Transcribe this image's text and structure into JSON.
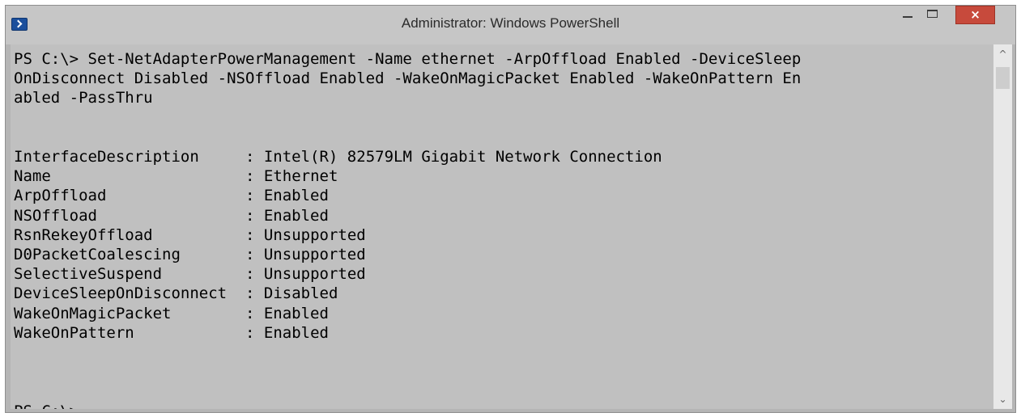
{
  "window": {
    "title": "Administrator: Windows PowerShell",
    "icon": "powershell-icon",
    "controls": {
      "close_glyph": "×"
    }
  },
  "console": {
    "command_lines": [
      "PS C:\\> Set-NetAdapterPowerManagement -Name ethernet -ArpOffload Enabled -DeviceSleep",
      "OnDisconnect Disabled -NSOffload Enabled -WakeOnMagicPacket Enabled -WakeOnPattern En",
      "abled -PassThru"
    ],
    "properties": [
      {
        "name": "InterfaceDescription",
        "value": "Intel(R) 82579LM Gigabit Network Connection"
      },
      {
        "name": "Name",
        "value": "Ethernet"
      },
      {
        "name": "ArpOffload",
        "value": "Enabled"
      },
      {
        "name": "NSOffload",
        "value": "Enabled"
      },
      {
        "name": "RsnRekeyOffload",
        "value": "Unsupported"
      },
      {
        "name": "D0PacketCoalescing",
        "value": "Unsupported"
      },
      {
        "name": "SelectiveSuspend",
        "value": "Unsupported"
      },
      {
        "name": "DeviceSleepOnDisconnect",
        "value": "Disabled"
      },
      {
        "name": "WakeOnMagicPacket",
        "value": "Enabled"
      },
      {
        "name": "WakeOnPattern",
        "value": "Enabled"
      }
    ],
    "prompt": "PS C:\\>"
  },
  "scrollbar": {
    "up_glyph": "^",
    "down_glyph": "⌄"
  },
  "colors": {
    "console_background": "#c0c0c0",
    "console_text": "#000000",
    "close_button": "#c74a3c",
    "titlebar": "#c6c6c6"
  }
}
